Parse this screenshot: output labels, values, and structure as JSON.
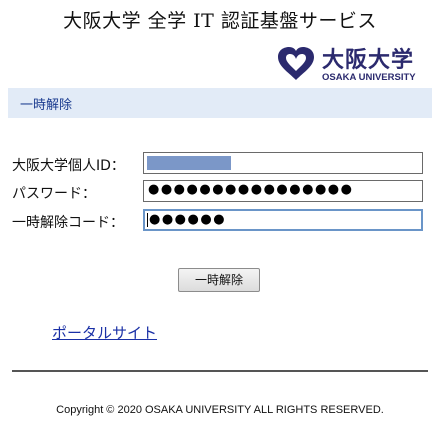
{
  "header": {
    "title": "大阪大学 全学 IT 認証基盤サービス"
  },
  "logo": {
    "icon": "osaka-university-logo-icon",
    "name_ja": "大阪大学",
    "name_en": "OSAKA UNIVERSITY",
    "color": "#2b2a6e"
  },
  "section": {
    "title": "一時解除",
    "bar_color": "#e2ebf7"
  },
  "form": {
    "id_label": "大阪大学個人ID：",
    "id_value": "",
    "password_label": "パスワード：",
    "password_value": "●●●●●●●●●●●●●●●●",
    "unlock_code_label": "一時解除コード：",
    "unlock_code_value": "●●●●●●",
    "submit_label": "一時解除"
  },
  "links": {
    "portal_site": "ポータルサイト"
  },
  "footer": {
    "copyright": "Copyright © 2020 OSAKA UNIVERSITY ALL RIGHTS RESERVED."
  },
  "colors": {
    "link": "#1a30a6",
    "active_border": "#6a95c8",
    "id_selection": "#7b97c8"
  }
}
